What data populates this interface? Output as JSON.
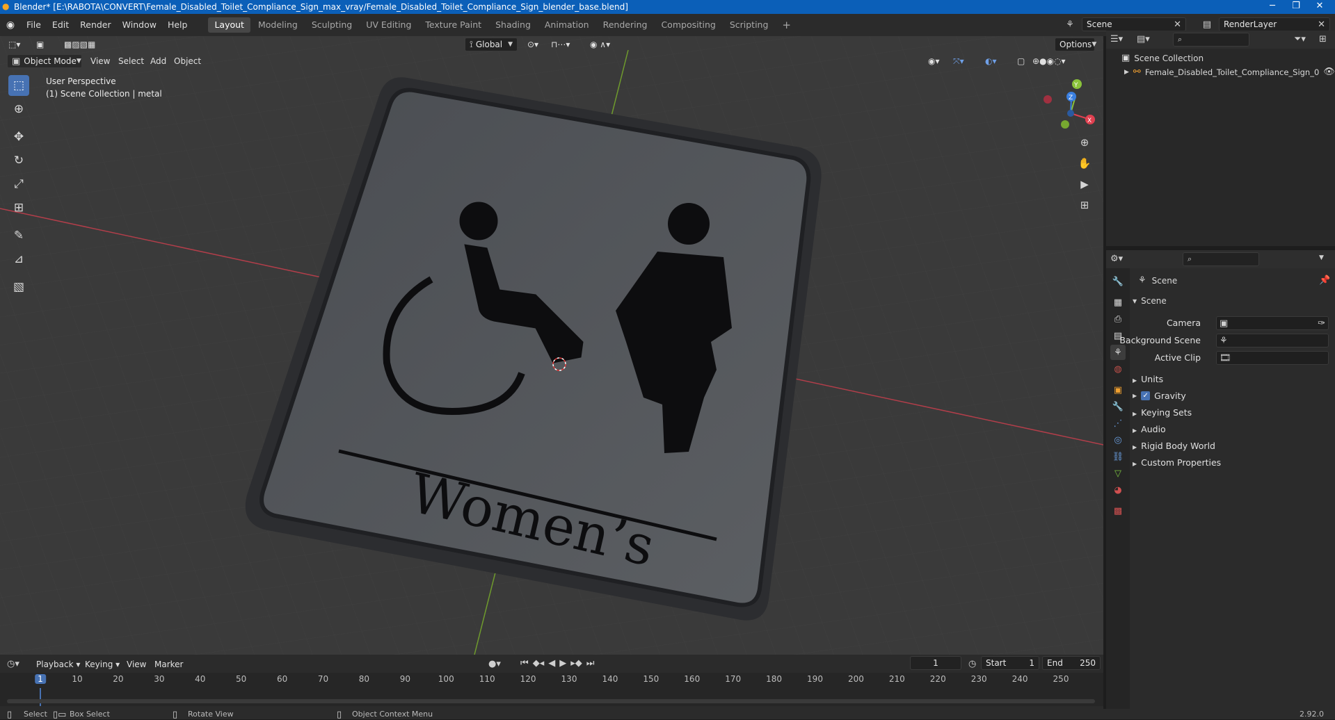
{
  "window": {
    "title": "Blender* [E:\\RABOTA\\CONVERT\\Female_Disabled_Toilet_Compliance_Sign_max_vray/Female_Disabled_Toilet_Compliance_Sign_blender_base.blend]"
  },
  "menubar": {
    "menus": [
      "File",
      "Edit",
      "Render",
      "Window",
      "Help"
    ],
    "workspaces": [
      "Layout",
      "Modeling",
      "Sculpting",
      "UV Editing",
      "Texture Paint",
      "Shading",
      "Animation",
      "Rendering",
      "Compositing",
      "Scripting"
    ],
    "active_workspace": "Layout",
    "scene": "Scene",
    "render_layer": "RenderLayer"
  },
  "viewport": {
    "mode": "Object Mode",
    "menus": [
      "View",
      "Select",
      "Add",
      "Object"
    ],
    "transform_orientation": "Global",
    "options_label": "Options",
    "info_line1": "User Perspective",
    "info_line2": "(1) Scene Collection | metal",
    "sign_text": "Women’s",
    "gizmo": {
      "x": "X",
      "y": "Y",
      "z": "Z"
    }
  },
  "outliner": {
    "root": "Scene Collection",
    "items": [
      "Female_Disabled_Toilet_Compliance_Sign_0"
    ]
  },
  "properties": {
    "header": "Scene",
    "panel": "Scene",
    "fields": [
      {
        "label": "Camera"
      },
      {
        "label": "Background Scene"
      },
      {
        "label": "Active Clip"
      }
    ],
    "sections": [
      "Units",
      "Gravity",
      "Keying Sets",
      "Audio",
      "Rigid Body World",
      "Custom Properties"
    ],
    "gravity_checked": true
  },
  "timeline": {
    "menus": [
      "Playback",
      "Keying",
      "View",
      "Marker"
    ],
    "current_frame": "1",
    "start_label": "Start",
    "start": "1",
    "end_label": "End",
    "end": "250",
    "ticks": [
      "1",
      "10",
      "20",
      "30",
      "40",
      "50",
      "60",
      "70",
      "80",
      "90",
      "100",
      "110",
      "120",
      "130",
      "140",
      "150",
      "160",
      "170",
      "180",
      "190",
      "200",
      "210",
      "220",
      "230",
      "240",
      "250"
    ]
  },
  "statusbar": {
    "select": "Select",
    "box_select": "Box Select",
    "rotate_view": "Rotate View",
    "context_menu": "Object Context Menu",
    "version": "2.92.0"
  },
  "colors": {
    "accent": "#4772b3",
    "title_bar": "#0b5fb8",
    "x_axis": "#e04050",
    "y_axis": "#8ac33a",
    "z_axis": "#3a7fe0"
  }
}
